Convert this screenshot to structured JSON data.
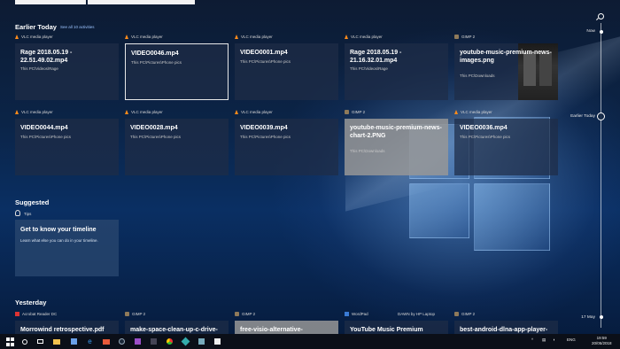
{
  "sections": {
    "earlier_today": {
      "title": "Earlier Today",
      "see_all": "See all 10 activities"
    },
    "suggested": {
      "title": "Suggested"
    },
    "yesterday": {
      "title": "Yesterday"
    }
  },
  "earlier_today_cards": [
    {
      "app": "VLC media player",
      "app_icon": "vlc-icon",
      "title": "Rage 2018.05.19 - 22.51.49.02.mp4",
      "path": "This PC\\Videos\\Rage",
      "selected": false
    },
    {
      "app": "VLC media player",
      "app_icon": "vlc-icon",
      "title": "VIDEO0046.mp4",
      "path": "This PC\\Pictures\\Phone pics",
      "selected": true
    },
    {
      "app": "VLC media player",
      "app_icon": "vlc-icon",
      "title": "VIDEO0001.mp4",
      "path": "This PC\\Pictures\\Phone pics",
      "selected": false
    },
    {
      "app": "VLC media player",
      "app_icon": "vlc-icon",
      "title": "Rage 2018.05.19 - 21.16.32.01.mp4",
      "path": "This PC\\Videos\\Rage",
      "selected": false
    },
    {
      "app": "GIMP 2",
      "app_icon": "gimp-icon",
      "title": "youtube-music-premium-news-images.png",
      "path": "This PC\\Downloads",
      "selected": false,
      "thumbnail": true
    },
    {
      "app": "VLC media player",
      "app_icon": "vlc-icon",
      "title": "VIDEO0044.mp4",
      "path": "This PC\\Pictures\\Phone pics",
      "selected": false
    },
    {
      "app": "VLC media player",
      "app_icon": "vlc-icon",
      "title": "VIDEO0028.mp4",
      "path": "This PC\\Pictures\\Phone pics",
      "selected": false
    },
    {
      "app": "VLC media player",
      "app_icon": "vlc-icon",
      "title": "VIDEO0039.mp4",
      "path": "This PC\\Pictures\\Phone pics",
      "selected": false
    },
    {
      "app": "GIMP 2",
      "app_icon": "gimp-icon",
      "title": "youtube-music-premium-news-chart-2.PNG",
      "path": "This PC\\Downloads",
      "selected": false,
      "gray": true
    },
    {
      "app": "VLC media player",
      "app_icon": "vlc-icon",
      "title": "VIDEO0036.mp4",
      "path": "This PC\\Pictures\\Phone pics",
      "selected": false
    }
  ],
  "suggested": {
    "tips_label": "Tips",
    "title": "Get to know your timeline",
    "body": "Learn what else you can do in your timeline."
  },
  "yesterday_cards": [
    {
      "app": "Acrobat Reader DC",
      "app_icon": "acrobat-icon",
      "title": "Morrowind retrospective.pdf"
    },
    {
      "app": "GIMP 2",
      "app_icon": "gimp-icon",
      "title": "make-space-clean-up-c-drive-"
    },
    {
      "app": "GIMP 2",
      "app_icon": "gimp-icon",
      "title": "free-visio-alternative-",
      "gray": true
    },
    {
      "app": "WordPad",
      "app_icon": "wordpad-icon",
      "title": "YouTube Music Premium",
      "device": "DAWN by HP Laptop"
    },
    {
      "app": "GIMP 2",
      "app_icon": "gimp-icon",
      "title": "best-android-dlna-app-player-"
    }
  ],
  "timeline": {
    "now": "Now",
    "earlier_today": "Earlier Today",
    "date": "17 May"
  },
  "taskbar": {
    "lang": "ENG",
    "time": "19:59",
    "date": "20/05/2018"
  }
}
